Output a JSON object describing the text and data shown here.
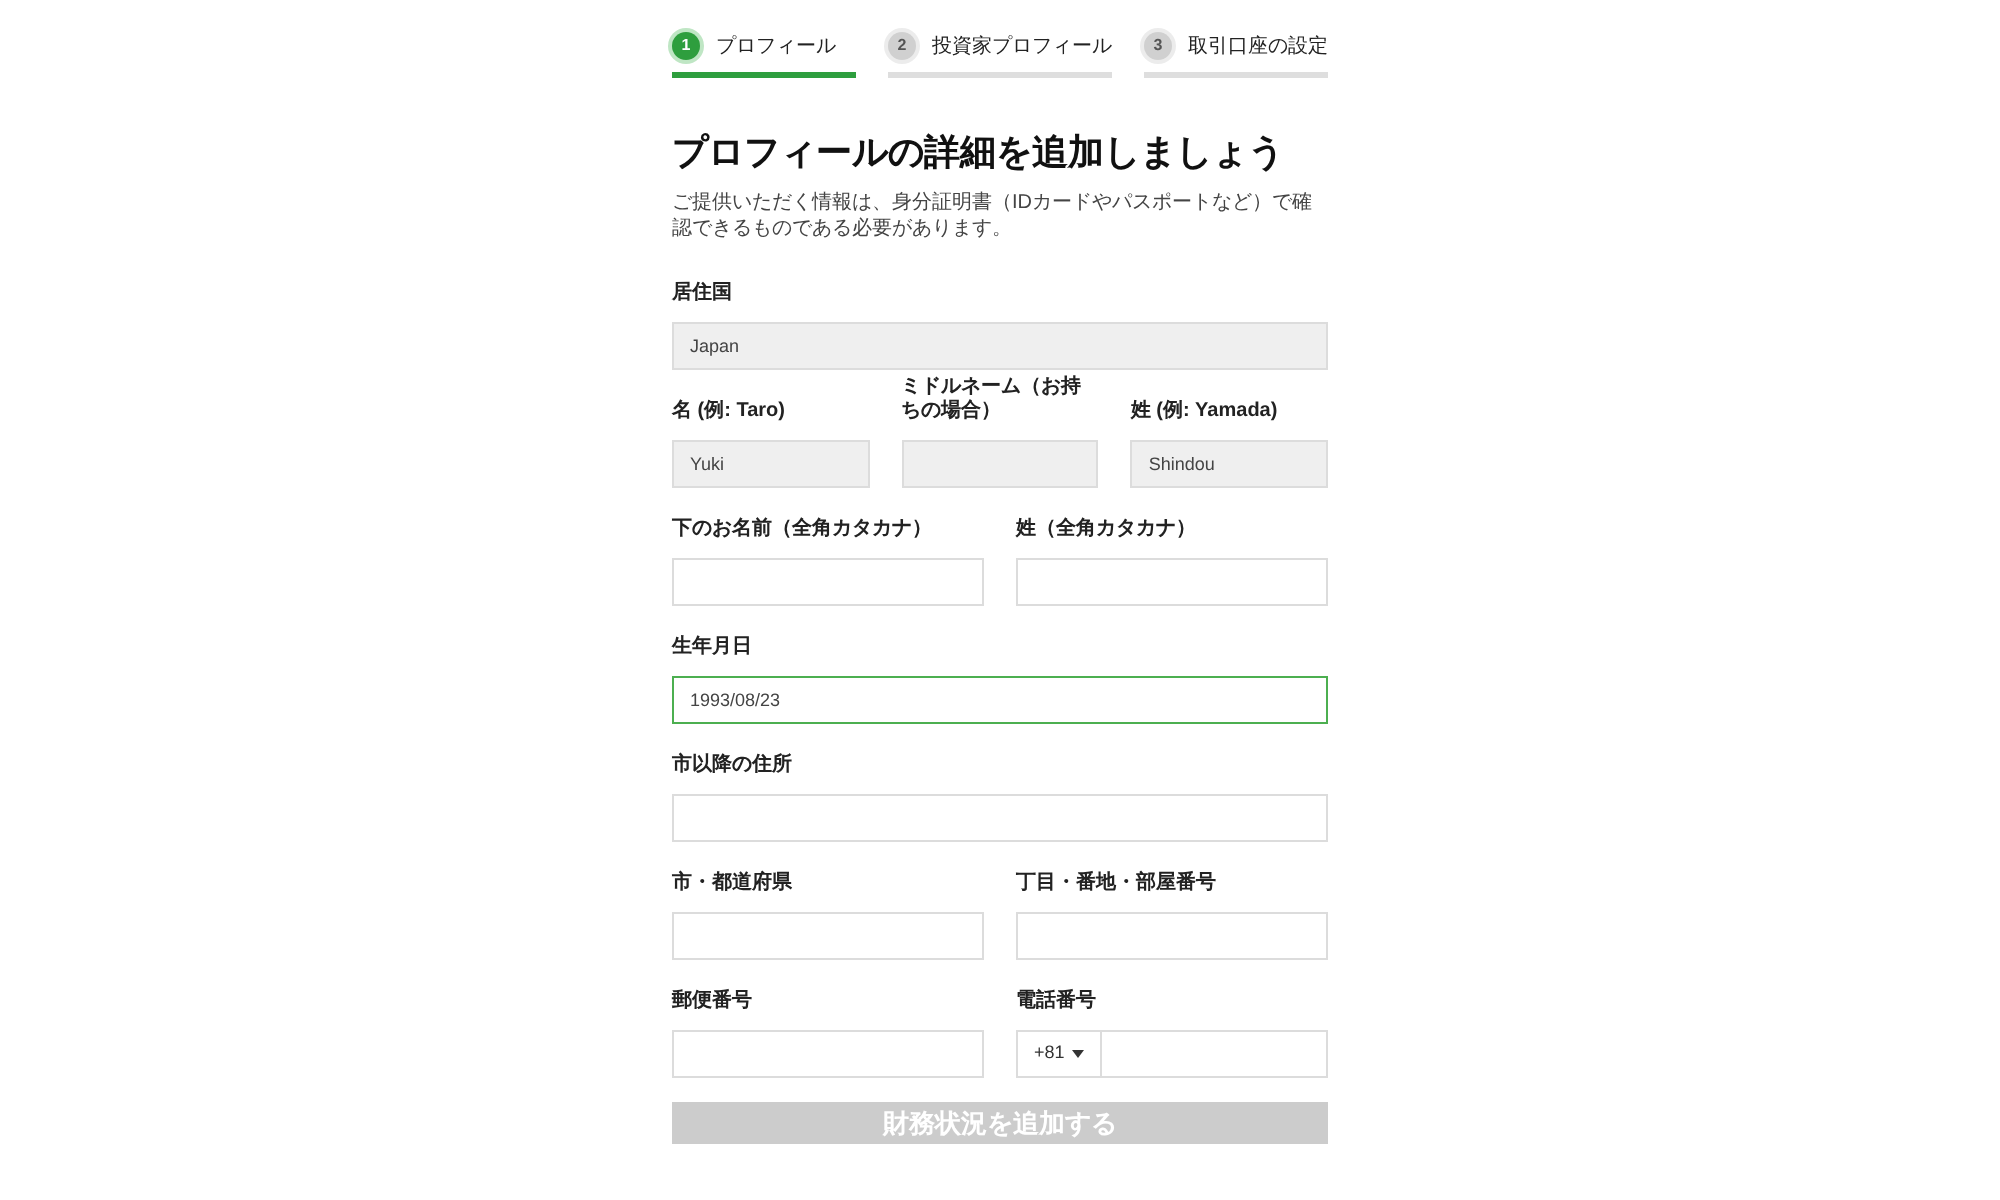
{
  "steps": [
    {
      "number": "1",
      "label": "プロフィール",
      "selected": true
    },
    {
      "number": "2",
      "label": "投資家プロフィール",
      "selected": false
    },
    {
      "number": "3",
      "label": "取引口座の設定",
      "selected": false
    }
  ],
  "heading": "プロフィールの詳細を追加しましょう",
  "description": "ご提供いただく情報は、身分証明書（IDカードやパスポートなど）で確認できるものである必要があります。",
  "rows": [
    {
      "fields": [
        {
          "kind": "text",
          "label": "居住国",
          "value": "Japan",
          "disabled": true,
          "focused": false
        }
      ]
    },
    {
      "fields": [
        {
          "kind": "text",
          "label": "名 (例: Taro)",
          "value": "Yuki",
          "disabled": true,
          "focused": false
        },
        {
          "kind": "text",
          "label": "ミドルネーム（お持ちの場合）",
          "disabled": true,
          "focused": false
        },
        {
          "kind": "text",
          "label": "姓 (例: Yamada)",
          "value": "Shindou",
          "disabled": true,
          "focused": false
        }
      ]
    },
    {
      "fields": [
        {
          "kind": "text",
          "label": "下のお名前（全角カタカナ）",
          "disabled": false,
          "focused": false
        },
        {
          "kind": "text",
          "label": "姓（全角カタカナ）",
          "disabled": false,
          "focused": false
        }
      ]
    },
    {
      "fields": [
        {
          "kind": "text",
          "label": "生年月日",
          "value": "1993/08/23",
          "disabled": false,
          "focused": true
        }
      ]
    },
    {
      "fields": [
        {
          "kind": "text",
          "label": "市以降の住所",
          "disabled": false,
          "focused": false
        }
      ]
    },
    {
      "fields": [
        {
          "kind": "text",
          "label": "市・都道府県",
          "disabled": false,
          "focused": false
        },
        {
          "kind": "text",
          "label": "丁目・番地・部屋番号",
          "disabled": false,
          "focused": false
        }
      ]
    },
    {
      "fields": [
        {
          "kind": "text",
          "label": "郵便番号",
          "disabled": false,
          "focused": false
        },
        {
          "kind": "phone",
          "label": "電話番号",
          "country_code": "+81",
          "disabled": false,
          "focused": false
        }
      ]
    }
  ],
  "submit": {
    "label": "財務状況を追加する",
    "disabled": true
  }
}
